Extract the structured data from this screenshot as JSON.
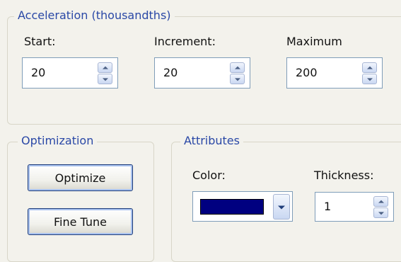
{
  "acceleration": {
    "title": "Acceleration (thousandths)",
    "start": {
      "label": "Start:",
      "value": "20"
    },
    "increment": {
      "label": "Increment:",
      "value": "20"
    },
    "maximum": {
      "label": "Maximum",
      "value": "200"
    }
  },
  "optimization": {
    "title": "Optimization",
    "optimize_label": "Optimize",
    "fine_tune_label": "Fine Tune"
  },
  "attributes": {
    "title": "Attributes",
    "color_label": "Color:",
    "color_value": "#000080",
    "thickness_label": "Thickness:",
    "thickness_value": "1"
  }
}
